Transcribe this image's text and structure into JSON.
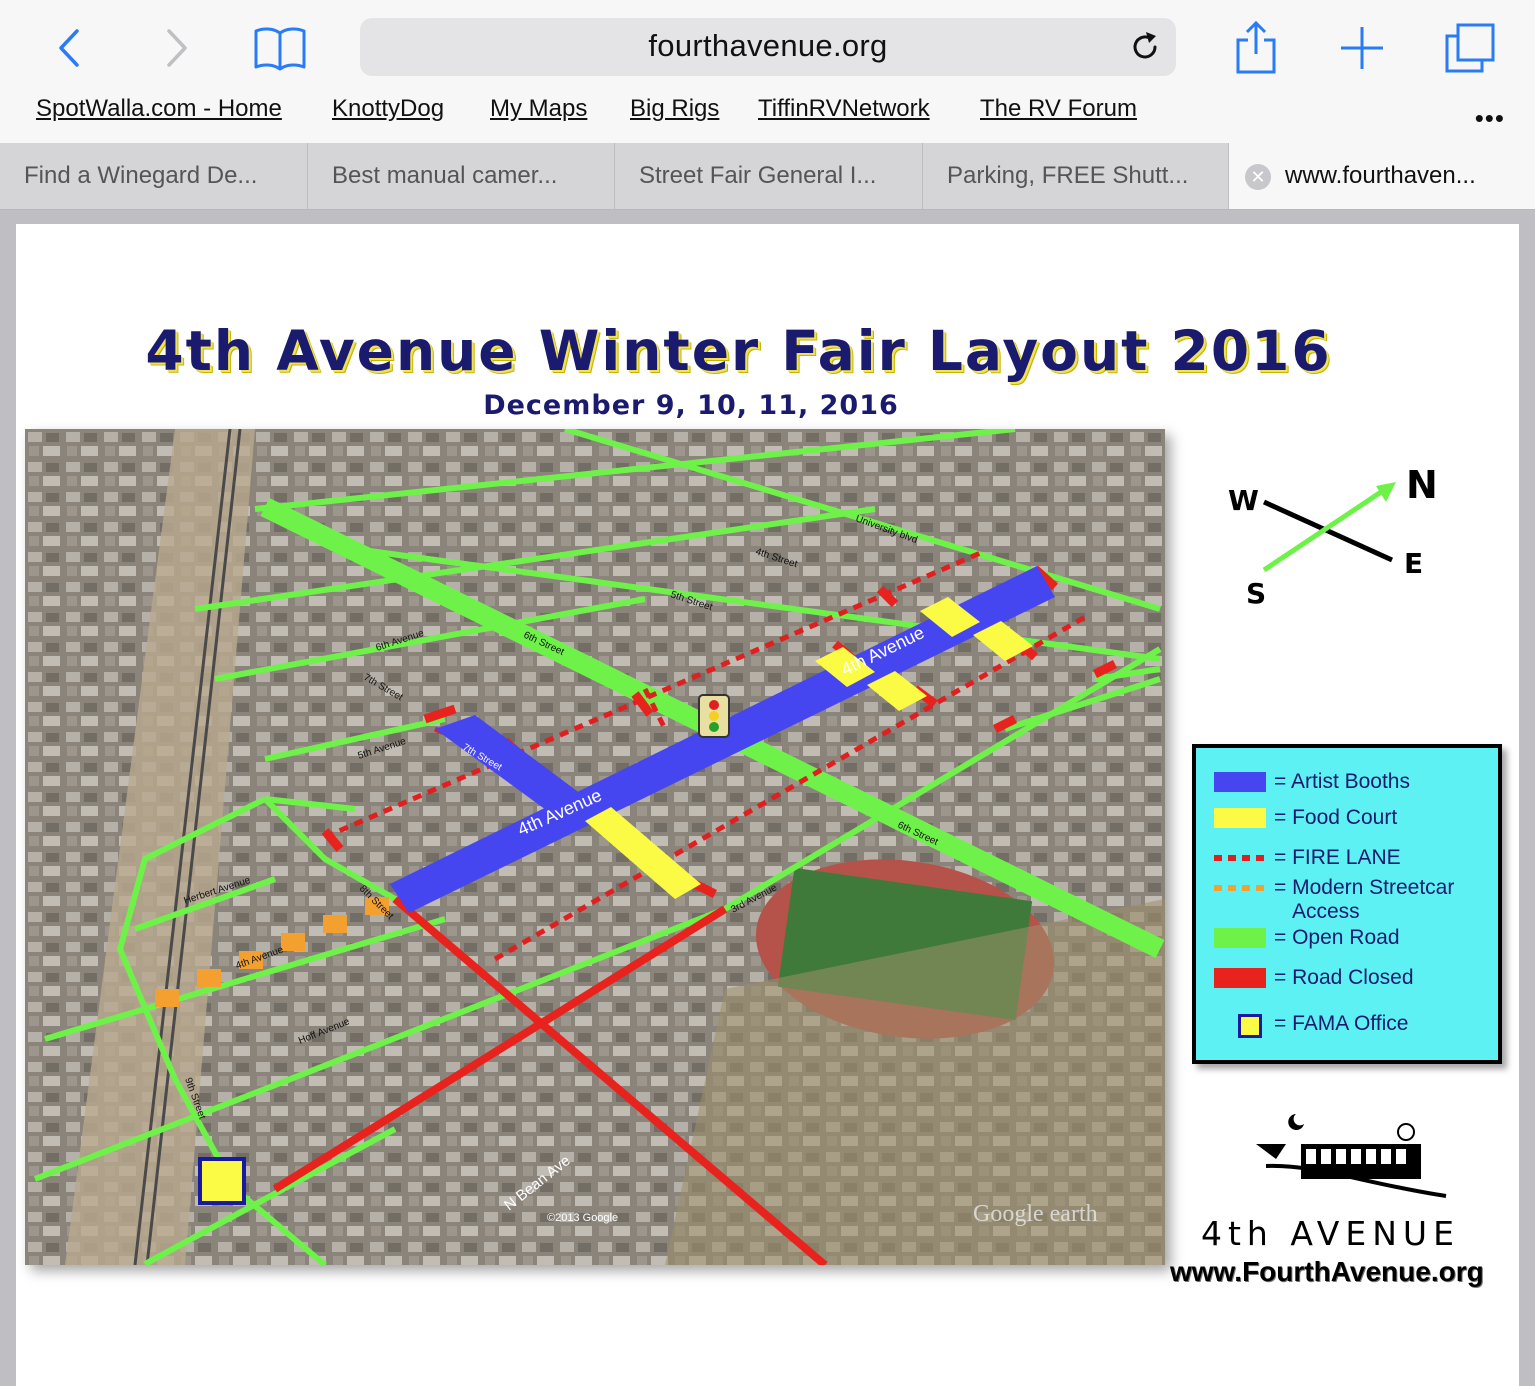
{
  "browser": {
    "address": "fourthavenue.org",
    "bookmarks": [
      "SpotWalla.com - Home",
      "KnottyDog",
      "My Maps",
      "Big Rigs",
      "TiffinRVNetwork",
      "The RV Forum"
    ],
    "more_label": "•••",
    "tabs": [
      "Find a Winegard De...",
      "Best manual camer...",
      "Street Fair General I...",
      "Parking, FREE Shutt...",
      "www.fourthaven..."
    ],
    "tab_close_label": "✕"
  },
  "flyer": {
    "title": "4th Avenue Winter Fair Layout 2016",
    "subtitle": "December 9, 10, 11, 2016",
    "compass": {
      "n": "N",
      "s": "S",
      "e": "E",
      "w": "W"
    },
    "map_labels": {
      "university": "University blvd",
      "fourth_street": "4th Street",
      "fifth_street": "5th Street",
      "sixth_street_a": "6th Street",
      "sixth_street_b": "6th Street",
      "sixth_avenue": "6th Avenue",
      "seventh_street_a": "7th Street",
      "seventh_street_b": "7th Street",
      "fifth_avenue": "5th Avenue",
      "fourth_avenue_a": "4th Avenue",
      "fourth_avenue_b": "4th Avenue",
      "fourth_avenue_c": "4th Avenue",
      "eighth_street": "8th Street",
      "herbert": "Herbert Avenue",
      "hoff": "Hoff Avenue",
      "ninth_street": "9th Street",
      "third_avenue": "3rd Avenue",
      "bean": "N Bean Ave",
      "copyright": "©2013 Google",
      "google_earth": "Google earth"
    },
    "legend": [
      {
        "label": "= Artist Booths",
        "color": "#4646f0"
      },
      {
        "label": "= Food Court",
        "color": "#fbfb46"
      },
      {
        "label": "= FIRE LANE",
        "color": "#e02020"
      },
      {
        "label": "= Modern Streetcar",
        "color": "#f4a030"
      },
      {
        "label": "Access",
        "color": ""
      },
      {
        "label": "= Open Road",
        "color": "#6ef24a"
      },
      {
        "label": "= Road Closed",
        "color": "#e8231e"
      },
      {
        "label": "= FAMA Office",
        "color": "#fbfb46"
      }
    ],
    "brand": {
      "name": "4th AVENUE",
      "url": "www.FourthAvenue.org"
    }
  }
}
